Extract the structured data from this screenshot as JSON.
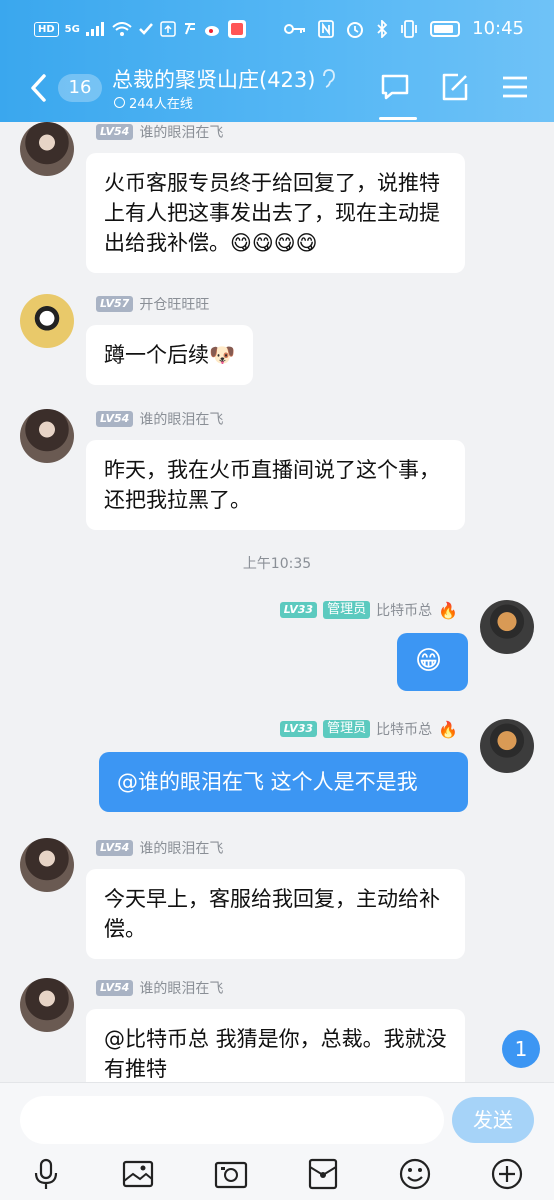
{
  "status_bar": {
    "left_chips": [
      "HD",
      "5G"
    ],
    "time": "10:45",
    "battery_percent": 85
  },
  "header": {
    "unread_count": "16",
    "title": "总裁的聚贤山庄(423)",
    "online": "244人在线"
  },
  "messages": [
    {
      "level": "LV54",
      "name": "谁的眼泪在飞",
      "text": "火币客服专员终于给回复了，说推特上有人把这事发出去了，现在主动提出给我补偿。😋😋😋😋"
    },
    {
      "level": "LV57",
      "name": "开仓旺旺旺",
      "text": "蹲一个后续🐶"
    },
    {
      "level": "LV54",
      "name": "谁的眼泪在飞",
      "text": "昨天，我在火币直播间说了这个事，还把我拉黑了。"
    },
    {
      "time": "上午10:35"
    },
    {
      "level": "LV33",
      "role": "管理员",
      "name": "比特币总",
      "text": "😁"
    },
    {
      "level": "LV33",
      "role": "管理员",
      "name": "比特币总",
      "text": "@谁的眼泪在飞 这个人是不是我"
    },
    {
      "level": "LV54",
      "name": "谁的眼泪在飞",
      "text": "今天早上，客服给我回复，主动给补偿。"
    },
    {
      "level": "LV54",
      "name": "谁的眼泪在飞",
      "text": "@比特币总 我猜是你，总裁。我就没有推特"
    }
  ],
  "new_message_badge": "1",
  "input": {
    "placeholder": "",
    "send_label": "发送"
  }
}
